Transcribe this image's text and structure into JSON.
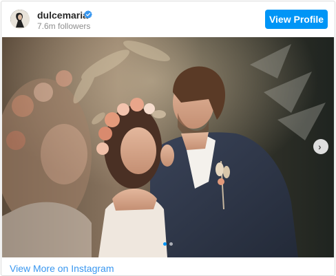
{
  "header": {
    "username": "dulcemaria",
    "followers": "7.6m followers",
    "view_profile_label": "View Profile"
  },
  "carousel": {
    "current_slide": 1,
    "total_slides": 2
  },
  "footer": {
    "view_more_label": "View More on Instagram"
  },
  "colors": {
    "accent": "#0095f6",
    "link": "#3897f0",
    "verified": "#3897f0"
  },
  "icons": {
    "verified": "verified-badge-icon",
    "next": "chevron-right-icon"
  }
}
